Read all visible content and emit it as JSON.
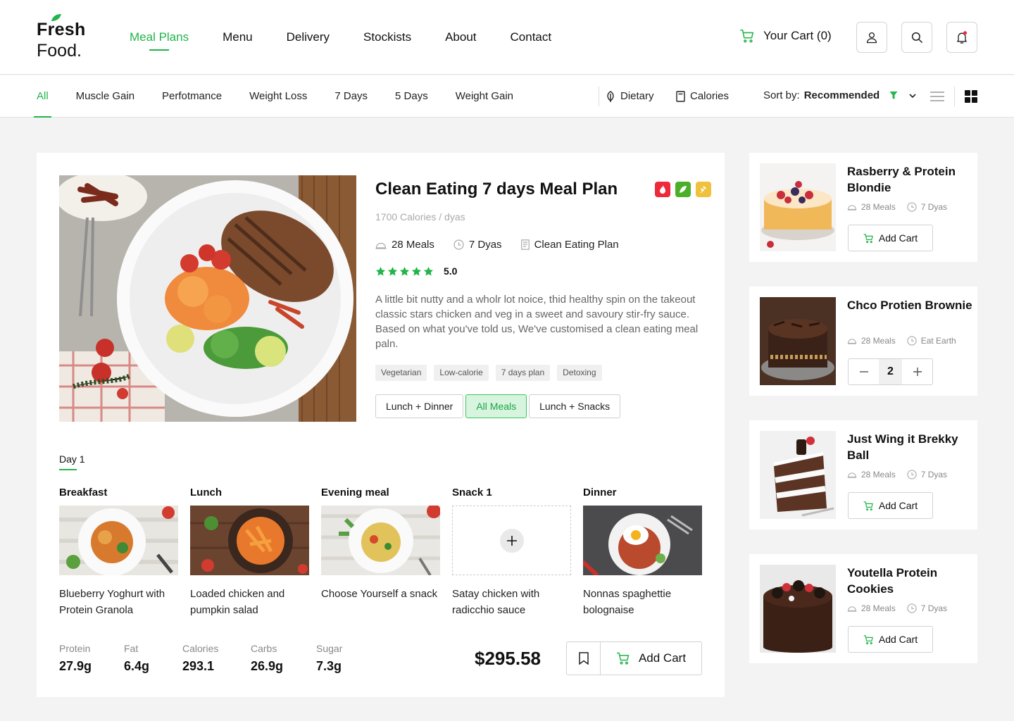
{
  "brand": {
    "line1": "Fresh",
    "line2": "Food."
  },
  "nav": [
    "Meal Plans",
    "Menu",
    "Delivery",
    "Stockists",
    "About",
    "Contact"
  ],
  "cart_label": "Your Cart (0)",
  "filters": {
    "tabs": [
      "All",
      "Muscle Gain",
      "Perfotmance",
      "Weight Loss",
      "7 Days",
      "5 Days",
      "Weight Gain"
    ],
    "dietary": "Dietary",
    "calories": "Calories",
    "sort_prefix": "Sort by:",
    "sort_value": "Recommended"
  },
  "product": {
    "title": "Clean Eating 7 days Meal Plan",
    "subtitle": "1700 Calories / dyas",
    "meals": "28 Meals",
    "duration": "7 Dyas",
    "plan": "Clean Eating Plan",
    "rating": "5.0",
    "rating_stars": 5,
    "description": "A little bit nutty and a wholr lot noice, thid healthy spin on the takeout classic stars chicken and veg in a sweet and savoury stir-fry sauce. Based on what you've told us, We've customised a clean eating meal paln.",
    "tags": [
      "Vegetarian",
      "Low-calorie",
      "7 days plan",
      "Detoxing"
    ],
    "options": [
      "Lunch + Dinner",
      "All Meals",
      "Lunch + Snacks"
    ],
    "selected_option": "All Meals",
    "badge_colors": [
      "#ee2a3a",
      "#4caf2a",
      "#f0c13c"
    ]
  },
  "day": {
    "label": "Day 1",
    "meals": [
      {
        "type": "Breakfast",
        "name": "Blueberry Yoghurt with Protein Granola"
      },
      {
        "type": "Lunch",
        "name": "Loaded chicken and pumpkin salad"
      },
      {
        "type": "Evening meal",
        "name": "Choose Yourself a snack"
      },
      {
        "type": "Snack 1",
        "name": "Satay chicken with radicchio sauce"
      },
      {
        "type": "Dinner",
        "name": "Nonnas spaghettie bolognaise"
      }
    ]
  },
  "nutrition": [
    {
      "label": "Protein",
      "value": "27.9g"
    },
    {
      "label": "Fat",
      "value": "6.4g"
    },
    {
      "label": "Calories",
      "value": "293.1"
    },
    {
      "label": "Carbs",
      "value": "26.9g"
    },
    {
      "label": "Sugar",
      "value": "7.3g"
    }
  ],
  "price": "$295.58",
  "add_cart": "Add Cart",
  "side": [
    {
      "title": "Rasberry & Protein Blondie",
      "meals": "28 Meals",
      "time": "7 Dyas",
      "button": "Add Cart"
    },
    {
      "title": "Chco Protien Brownie",
      "meals": "28 Meals",
      "time": "Eat Earth",
      "quantity": "2"
    },
    {
      "title": "Just Wing it Brekky Ball",
      "meals": "28 Meals",
      "time": "7 Dyas",
      "button": "Add Cart"
    },
    {
      "title": "Youtella Protein Cookies",
      "meals": "28 Meals",
      "time": "7 Dyas",
      "button": "Add Cart"
    }
  ],
  "colors": {
    "accent": "#21b54a",
    "selected_bg": "#d6f4de",
    "notification_dot": "#ee2a3a"
  }
}
